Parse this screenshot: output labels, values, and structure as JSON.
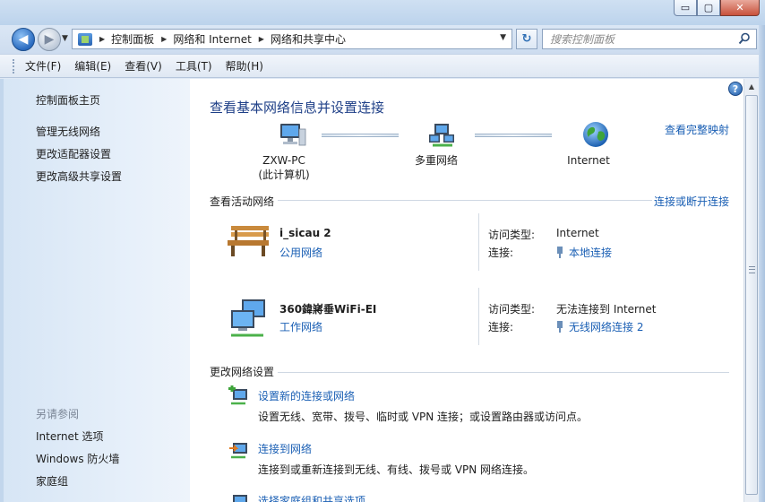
{
  "window": {
    "buttons": {
      "minimize": "▭",
      "maximize": "▢",
      "close": "✕"
    }
  },
  "navigation": {
    "back": "◀",
    "forward": "▶",
    "breadcrumbs": [
      "控制面板",
      "网络和 Internet",
      "网络和共享中心"
    ],
    "search_placeholder": "搜索控制面板"
  },
  "menu": [
    "文件(F)",
    "编辑(E)",
    "查看(V)",
    "工具(T)",
    "帮助(H)"
  ],
  "sidebar": {
    "home": "控制面板主页",
    "links": [
      "管理无线网络",
      "更改适配器设置",
      "更改高级共享设置"
    ],
    "see_also_title": "另请参阅",
    "see_also": [
      "Internet 选项",
      "Windows 防火墙",
      "家庭组"
    ]
  },
  "main": {
    "title": "查看基本网络信息并设置连接",
    "view_full_map": "查看完整映射",
    "map": {
      "computer_name": "ZXW-PC",
      "computer_sub": "(此计算机)",
      "middle": "多重网络",
      "internet": "Internet"
    },
    "active_networks_label": "查看活动网络",
    "connect_disconnect": "连接或断开连接",
    "networks": [
      {
        "name": "i_sicau  2",
        "type": "公用网络",
        "access_label": "访问类型:",
        "access_value": "Internet",
        "connections_label": "连接:",
        "connection": "本地连接"
      },
      {
        "name": "360鍏嶈垂WiFi-EI",
        "type": "工作网络",
        "access_label": "访问类型:",
        "access_value": "无法连接到 Internet",
        "connections_label": "连接:",
        "connection": "无线网络连接 2"
      }
    ],
    "change_settings_label": "更改网络设置",
    "tasks": [
      {
        "title": "设置新的连接或网络",
        "desc": "设置无线、宽带、拨号、临时或 VPN 连接；或设置路由器或访问点。"
      },
      {
        "title": "连接到网络",
        "desc": "连接到或重新连接到无线、有线、拨号或 VPN 网络连接。"
      },
      {
        "title": "选择家庭组和共享选项",
        "desc": ""
      }
    ],
    "help": "?"
  },
  "colors": {
    "link": "#1a5fb4",
    "title": "#1e3f87",
    "sidebar_bg": "#e7f0fa"
  }
}
